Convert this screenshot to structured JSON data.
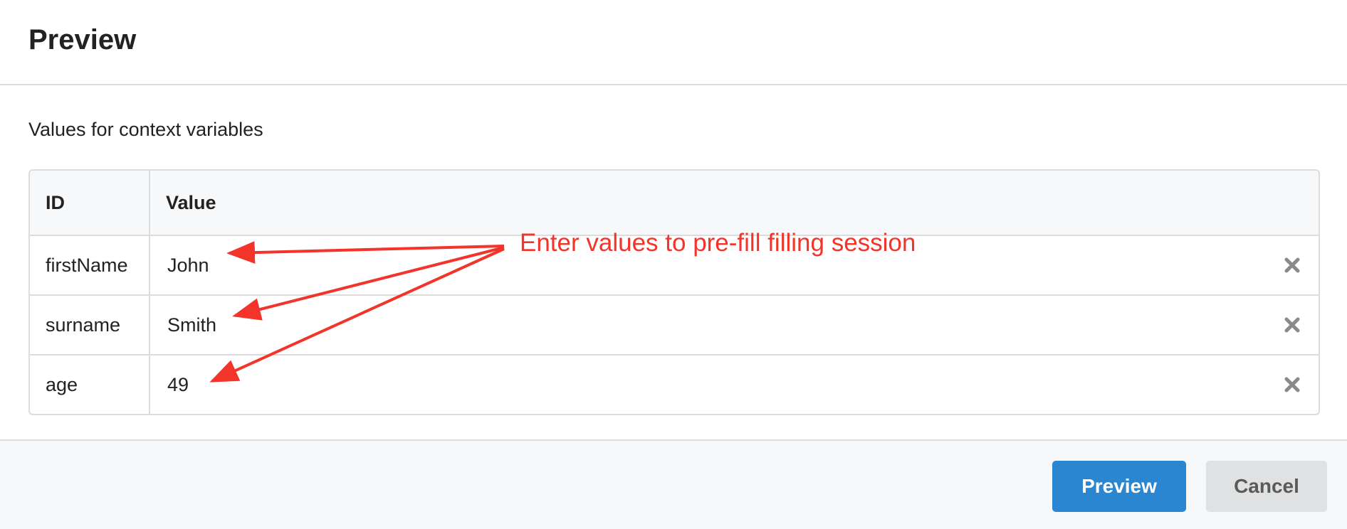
{
  "dialog": {
    "title": "Preview"
  },
  "body": {
    "section_label": "Values for context variables"
  },
  "table": {
    "headers": {
      "id": "ID",
      "value": "Value"
    },
    "rows": [
      {
        "id": "firstName",
        "value": "John"
      },
      {
        "id": "surname",
        "value": "Smith"
      },
      {
        "id": "age",
        "value": "49"
      }
    ]
  },
  "annotation": {
    "text": "Enter values to pre-fill filling session",
    "color": "#f2342a"
  },
  "footer": {
    "preview_label": "Preview",
    "cancel_label": "Cancel"
  },
  "colors": {
    "primary_button": "#2a86d0",
    "secondary_button": "#e0e1e2",
    "remove_icon": "#8a8a8a"
  },
  "icons": {
    "remove": "close-icon"
  }
}
